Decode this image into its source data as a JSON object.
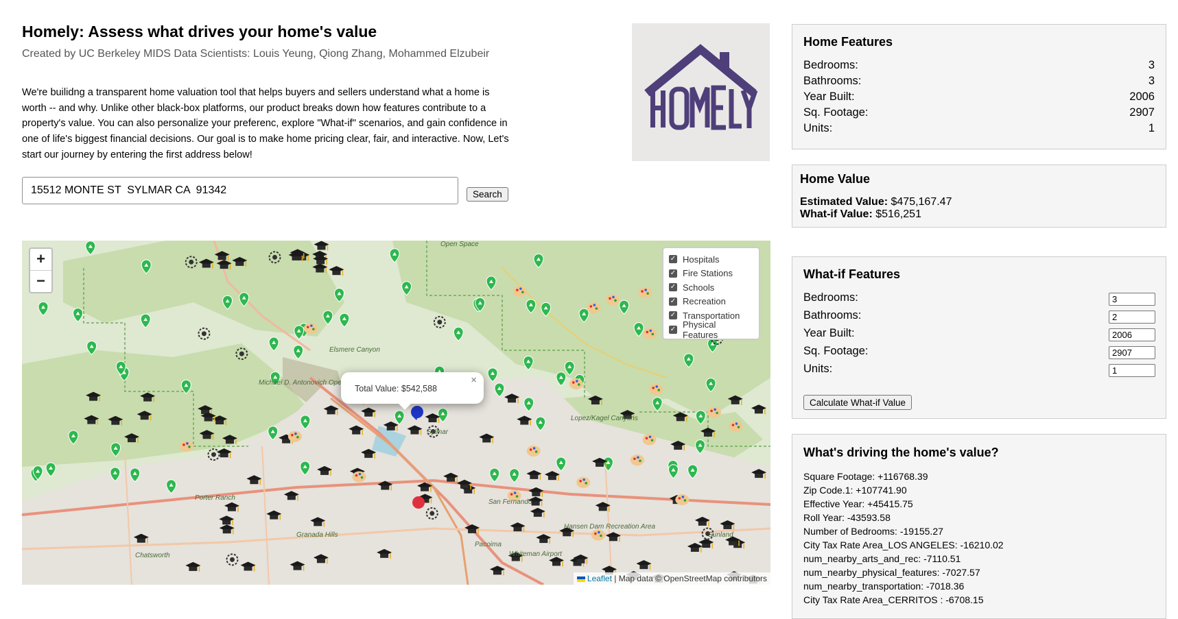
{
  "header": {
    "title": "Homely: Assess what drives your home's value",
    "subtitle": "Created by UC Berkeley MIDS Data Scientists: Louis Yeung, Qiong Zhang, Mohammed Elzubeir",
    "intro": "We're builidng a transparent home valuation tool that helps buyers and sellers understand what a home is worth -- and why. Unlike other black-box platforms, our product breaks down how features contribute to a property's value. You can also personalize your preferenc, explore \"What-if\" scenarios, and gain confidence in one of life's biggest financial decisions. Our goal is to make home pricing clear, fair, and interactive. Now, Let's start our journey by entering the first address below!"
  },
  "logo": {
    "text": "HOMELY",
    "color": "#4e3f7a",
    "background": "#e9e8e6"
  },
  "search": {
    "value": "15512 MONTE ST  SYLMAR CA  91342",
    "button_label": "Search"
  },
  "map": {
    "zoom_in": "+",
    "zoom_out": "−",
    "layers": [
      {
        "label": "Hospitals",
        "checked": true
      },
      {
        "label": "Fire Stations",
        "checked": true
      },
      {
        "label": "Schools",
        "checked": true
      },
      {
        "label": "Recreation",
        "checked": true
      },
      {
        "label": "Transportation",
        "checked": true
      },
      {
        "label": "Physical Features",
        "checked": true
      }
    ],
    "popup": {
      "text": "Total Value: $542,588",
      "close": "×"
    },
    "attribution": {
      "leaflet": "Leaflet",
      "rest": " | Map data © OpenStreetMap contributors"
    },
    "place_labels": [
      "Open Space",
      "Elsmere Canyon",
      "Michael D. Antonovich Open Space",
      "Lopez/Kagel Canyons",
      "Granada Hills",
      "Pacoima",
      "Hansen Dam Recreation Area",
      "Whiteman Airport",
      "Porter Ranch",
      "Chatsworth",
      "San Fernando",
      "Sylmar",
      "Sunland"
    ],
    "colors": {
      "park": "#c8dcae",
      "urban": "#e3e0da",
      "road": "#f2b8a0",
      "highway": "#e8927c",
      "marker_green": "#2eb84f",
      "school_black": "#1a1a1a"
    }
  },
  "home_features": {
    "title": "Home Features",
    "rows": [
      {
        "label": "Bedrooms:",
        "value": "3"
      },
      {
        "label": "Bathrooms:",
        "value": "3"
      },
      {
        "label": "Year Built:",
        "value": "2006"
      },
      {
        "label": "Sq. Footage:",
        "value": "2907"
      },
      {
        "label": "Units:",
        "value": "1"
      }
    ]
  },
  "home_value": {
    "title": "Home Value",
    "estimated_label": "Estimated Value:",
    "estimated_value": " $475,167.47",
    "whatif_label": "What-if Value:",
    "whatif_value": " $516,251"
  },
  "whatif": {
    "title": "What-if Features",
    "rows": [
      {
        "label": "Bedrooms:",
        "value": "3"
      },
      {
        "label": "Bathrooms:",
        "value": "2"
      },
      {
        "label": "Year Built:",
        "value": "2006"
      },
      {
        "label": "Sq. Footage:",
        "value": "2907"
      },
      {
        "label": "Units:",
        "value": "1"
      }
    ],
    "button_label": "Calculate What-if Value"
  },
  "drivers": {
    "title": "What's driving the home's value?",
    "items": [
      "Square Footage: +116768.39",
      "Zip Code.1: +107741.90",
      "Effective Year: +45415.75",
      "Roll Year: -43593.58",
      "Number of Bedrooms: -19155.27",
      "City Tax Rate Area_LOS ANGELES: -16210.02",
      "num_nearby_arts_and_rec: -7110.51",
      "num_nearby_physical_features: -7027.57",
      "num_nearby_transportation: -7018.36",
      "City Tax Rate Area_CERRITOS : -6708.15"
    ]
  }
}
